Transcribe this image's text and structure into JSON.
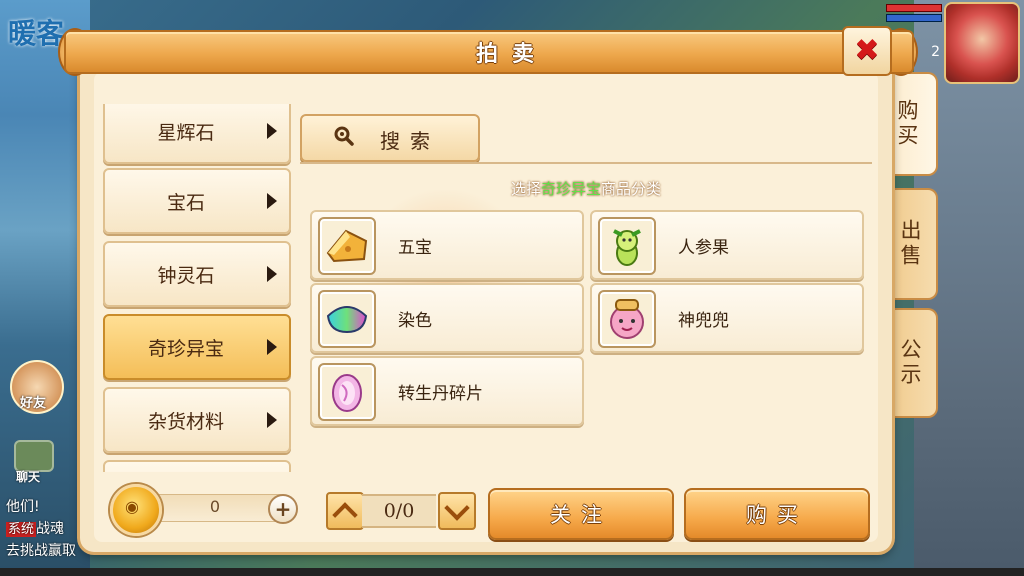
{
  "title": "拍卖",
  "side_tabs": [
    "购买",
    "出售",
    "公示"
  ],
  "categories": [
    "星辉石",
    "宝石",
    "钟灵石",
    "奇珍异宝",
    "杂货材料"
  ],
  "search_label": "搜索",
  "hint": {
    "prefix": "选择",
    "highlight": "奇珍异宝",
    "suffix": "商品分类"
  },
  "items": [
    "五宝",
    "人参果",
    "染色",
    "神兜兜",
    "转生丹碎片"
  ],
  "coin_value": "0",
  "plus_label": "+",
  "pagination": "0/0",
  "follow_label": "关注",
  "buy_label": "购买",
  "background": {
    "friend_label": "好友",
    "chat_label": "聊天",
    "chat_lines": [
      "他们!",
      "战魂",
      "去挑战赢取"
    ],
    "system_tag": "系统",
    "level": "2"
  }
}
